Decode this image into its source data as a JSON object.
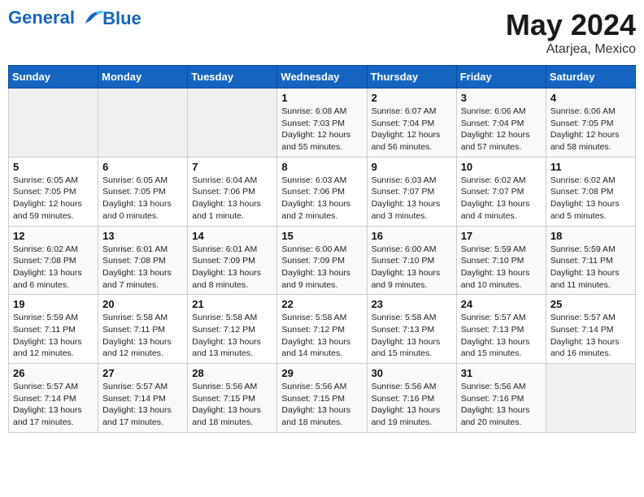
{
  "header": {
    "logo_line1": "General",
    "logo_line2": "Blue",
    "month_title": "May 2024",
    "location": "Atarjea, Mexico"
  },
  "weekdays": [
    "Sunday",
    "Monday",
    "Tuesday",
    "Wednesday",
    "Thursday",
    "Friday",
    "Saturday"
  ],
  "weeks": [
    [
      {
        "day": "",
        "info": ""
      },
      {
        "day": "",
        "info": ""
      },
      {
        "day": "",
        "info": ""
      },
      {
        "day": "1",
        "info": "Sunrise: 6:08 AM\nSunset: 7:03 PM\nDaylight: 12 hours\nand 55 minutes."
      },
      {
        "day": "2",
        "info": "Sunrise: 6:07 AM\nSunset: 7:04 PM\nDaylight: 12 hours\nand 56 minutes."
      },
      {
        "day": "3",
        "info": "Sunrise: 6:06 AM\nSunset: 7:04 PM\nDaylight: 12 hours\nand 57 minutes."
      },
      {
        "day": "4",
        "info": "Sunrise: 6:06 AM\nSunset: 7:05 PM\nDaylight: 12 hours\nand 58 minutes."
      }
    ],
    [
      {
        "day": "5",
        "info": "Sunrise: 6:05 AM\nSunset: 7:05 PM\nDaylight: 12 hours\nand 59 minutes."
      },
      {
        "day": "6",
        "info": "Sunrise: 6:05 AM\nSunset: 7:05 PM\nDaylight: 13 hours\nand 0 minutes."
      },
      {
        "day": "7",
        "info": "Sunrise: 6:04 AM\nSunset: 7:06 PM\nDaylight: 13 hours\nand 1 minute."
      },
      {
        "day": "8",
        "info": "Sunrise: 6:03 AM\nSunset: 7:06 PM\nDaylight: 13 hours\nand 2 minutes."
      },
      {
        "day": "9",
        "info": "Sunrise: 6:03 AM\nSunset: 7:07 PM\nDaylight: 13 hours\nand 3 minutes."
      },
      {
        "day": "10",
        "info": "Sunrise: 6:02 AM\nSunset: 7:07 PM\nDaylight: 13 hours\nand 4 minutes."
      },
      {
        "day": "11",
        "info": "Sunrise: 6:02 AM\nSunset: 7:08 PM\nDaylight: 13 hours\nand 5 minutes."
      }
    ],
    [
      {
        "day": "12",
        "info": "Sunrise: 6:02 AM\nSunset: 7:08 PM\nDaylight: 13 hours\nand 6 minutes."
      },
      {
        "day": "13",
        "info": "Sunrise: 6:01 AM\nSunset: 7:08 PM\nDaylight: 13 hours\nand 7 minutes."
      },
      {
        "day": "14",
        "info": "Sunrise: 6:01 AM\nSunset: 7:09 PM\nDaylight: 13 hours\nand 8 minutes."
      },
      {
        "day": "15",
        "info": "Sunrise: 6:00 AM\nSunset: 7:09 PM\nDaylight: 13 hours\nand 9 minutes."
      },
      {
        "day": "16",
        "info": "Sunrise: 6:00 AM\nSunset: 7:10 PM\nDaylight: 13 hours\nand 9 minutes."
      },
      {
        "day": "17",
        "info": "Sunrise: 5:59 AM\nSunset: 7:10 PM\nDaylight: 13 hours\nand 10 minutes."
      },
      {
        "day": "18",
        "info": "Sunrise: 5:59 AM\nSunset: 7:11 PM\nDaylight: 13 hours\nand 11 minutes."
      }
    ],
    [
      {
        "day": "19",
        "info": "Sunrise: 5:59 AM\nSunset: 7:11 PM\nDaylight: 13 hours\nand 12 minutes."
      },
      {
        "day": "20",
        "info": "Sunrise: 5:58 AM\nSunset: 7:11 PM\nDaylight: 13 hours\nand 12 minutes."
      },
      {
        "day": "21",
        "info": "Sunrise: 5:58 AM\nSunset: 7:12 PM\nDaylight: 13 hours\nand 13 minutes."
      },
      {
        "day": "22",
        "info": "Sunrise: 5:58 AM\nSunset: 7:12 PM\nDaylight: 13 hours\nand 14 minutes."
      },
      {
        "day": "23",
        "info": "Sunrise: 5:58 AM\nSunset: 7:13 PM\nDaylight: 13 hours\nand 15 minutes."
      },
      {
        "day": "24",
        "info": "Sunrise: 5:57 AM\nSunset: 7:13 PM\nDaylight: 13 hours\nand 15 minutes."
      },
      {
        "day": "25",
        "info": "Sunrise: 5:57 AM\nSunset: 7:14 PM\nDaylight: 13 hours\nand 16 minutes."
      }
    ],
    [
      {
        "day": "26",
        "info": "Sunrise: 5:57 AM\nSunset: 7:14 PM\nDaylight: 13 hours\nand 17 minutes."
      },
      {
        "day": "27",
        "info": "Sunrise: 5:57 AM\nSunset: 7:14 PM\nDaylight: 13 hours\nand 17 minutes."
      },
      {
        "day": "28",
        "info": "Sunrise: 5:56 AM\nSunset: 7:15 PM\nDaylight: 13 hours\nand 18 minutes."
      },
      {
        "day": "29",
        "info": "Sunrise: 5:56 AM\nSunset: 7:15 PM\nDaylight: 13 hours\nand 18 minutes."
      },
      {
        "day": "30",
        "info": "Sunrise: 5:56 AM\nSunset: 7:16 PM\nDaylight: 13 hours\nand 19 minutes."
      },
      {
        "day": "31",
        "info": "Sunrise: 5:56 AM\nSunset: 7:16 PM\nDaylight: 13 hours\nand 20 minutes."
      },
      {
        "day": "",
        "info": ""
      }
    ]
  ]
}
